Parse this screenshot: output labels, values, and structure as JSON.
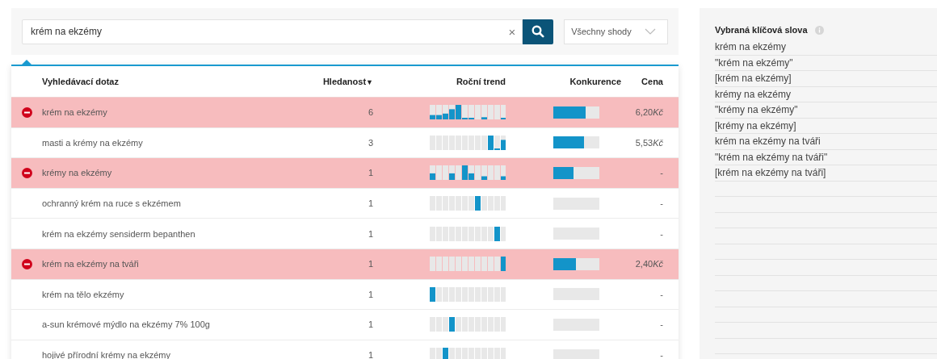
{
  "search": {
    "value": "krém na ekzémy",
    "clear": "×",
    "match_type": "Všechny shody"
  },
  "table": {
    "columns": [
      {
        "label": "Vyhledávací dotaz"
      },
      {
        "label": "Hledanost",
        "sort": "▼"
      },
      {
        "label": "Roční trend"
      },
      {
        "label": "Konkurence"
      },
      {
        "label": "Cena"
      }
    ],
    "rows": [
      {
        "query": "krém na ekzémy",
        "blocked": true,
        "volume": "6",
        "competition": {
          "level": 0.7
        },
        "price": "6,20",
        "currency": "Kč"
      },
      {
        "query": "masti a krémy na ekzémy",
        "blocked": false,
        "volume": "3",
        "competition": {
          "level": 0.67
        },
        "price": "5,53",
        "currency": "Kč"
      },
      {
        "query": "krémy na ekzémy",
        "blocked": true,
        "volume": "1",
        "competition": {
          "level": 0.44
        },
        "price": "-"
      },
      {
        "query": "ochranný krém na ruce s ekzémem",
        "blocked": false,
        "volume": "1",
        "price": "-"
      },
      {
        "query": "krém na ekzémy sensiderm bepanthen",
        "blocked": false,
        "volume": "1",
        "price": "-"
      },
      {
        "query": "krém na ekzémy na tváři",
        "blocked": true,
        "volume": "1",
        "competition": {
          "level": 0.49
        },
        "price": "2,40",
        "currency": "Kč"
      },
      {
        "query": "krém na tělo ekzémy",
        "blocked": false,
        "volume": "1",
        "price": "-"
      },
      {
        "query": "a-sun krémové mýdlo na ekzémy 7% 100g",
        "blocked": false,
        "volume": "1",
        "price": "-"
      },
      {
        "query": "hojivé přírodní krémy na ekzémy",
        "blocked": false,
        "volume": "1",
        "price": "-"
      }
    ]
  },
  "selected_keywords": {
    "title": "Vybraná klíčová slova",
    "items": [
      "krém na ekzémy",
      "\"krém na ekzémy\"",
      "[krém na ekzémy]",
      "krémy na ekzémy",
      "\"krémy na ekzémy\"",
      "[krémy na ekzémy]",
      "krém na ekzémy na tváři",
      "\"krém na ekzémy na tváři\"",
      "[krém na ekzémy na tváři]"
    ]
  }
}
